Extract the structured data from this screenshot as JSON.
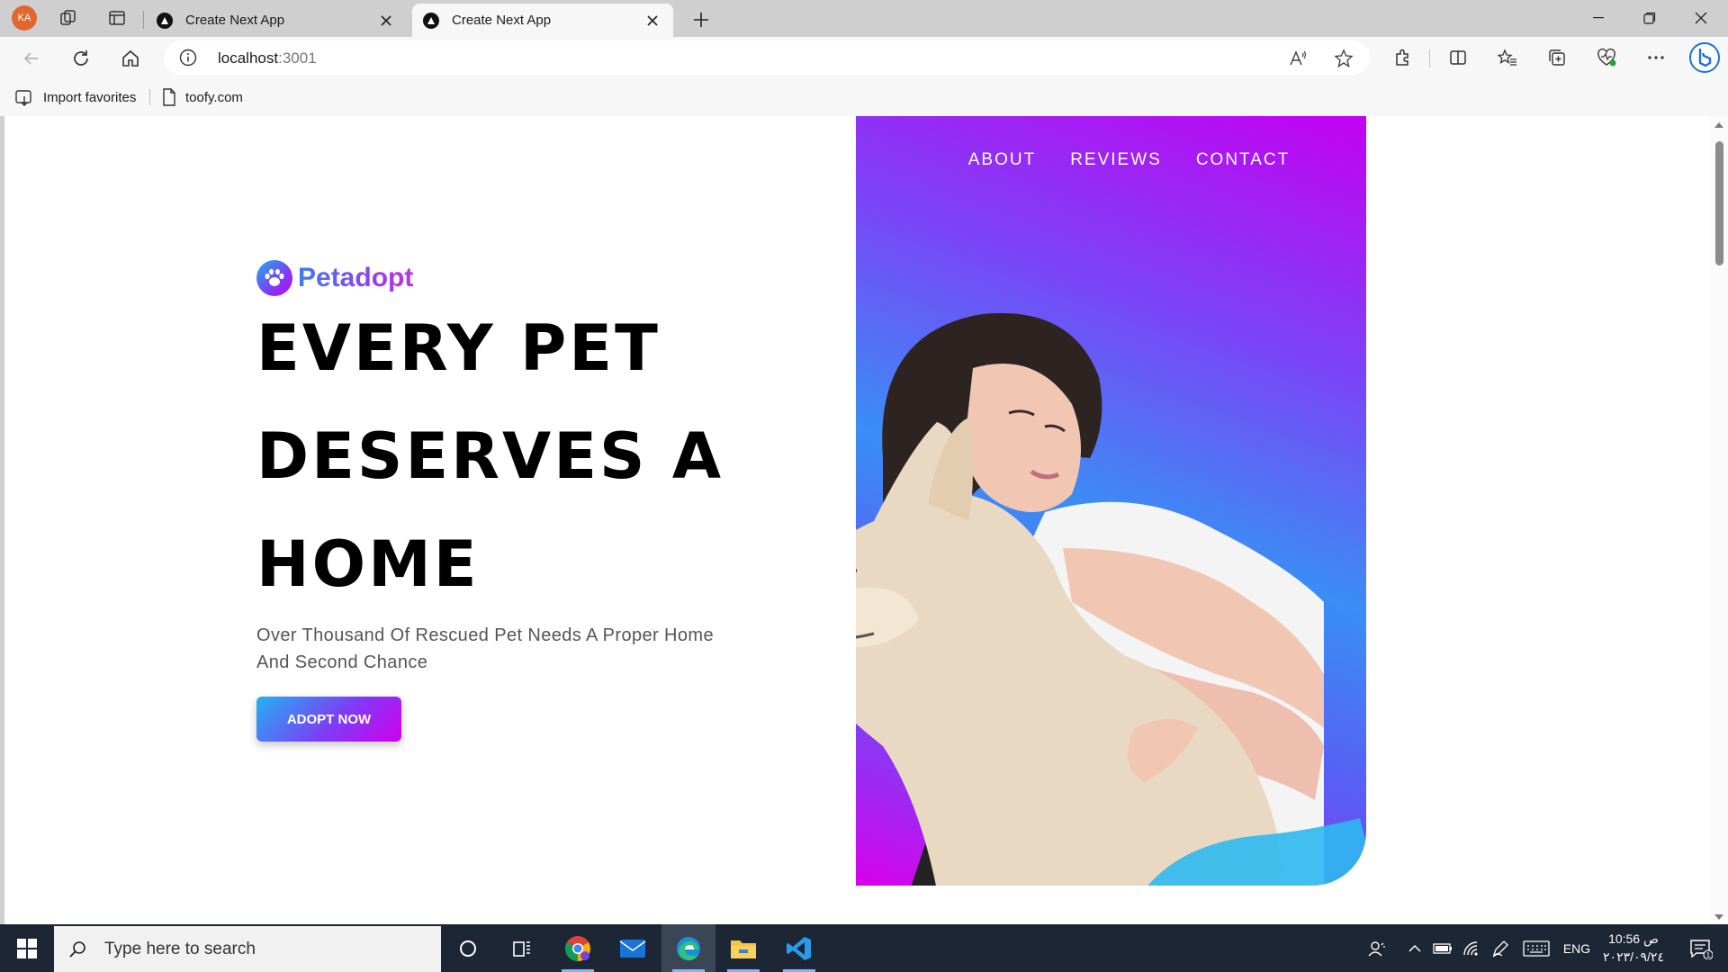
{
  "browser": {
    "profile_initials": "KA",
    "tabs": [
      {
        "title": "Create Next App",
        "active": false
      },
      {
        "title": "Create Next App",
        "active": true
      }
    ],
    "address": {
      "host": "localhost",
      "port": ":3001"
    },
    "favorites": [
      {
        "label": "Import favorites",
        "icon": "import-favorites-icon"
      },
      {
        "label": "toofy.com",
        "icon": "page-icon"
      }
    ]
  },
  "page": {
    "brand": "Petadopt",
    "headline": [
      "EVERY PET",
      "DESERVES A",
      "HOME"
    ],
    "subtitle": "Over Thousand Of Rescued Pet Needs A Proper Home And Second Chance",
    "cta": "ADOPT NOW",
    "nav": [
      "ABOUT",
      "REVIEWS",
      "CONTACT"
    ],
    "colors": {
      "gradient_start": "#1eb1f3",
      "gradient_mid": "#7d3cf5",
      "gradient_end": "#d000ee"
    }
  },
  "taskbar": {
    "search_placeholder": "Type here to search",
    "language": "ENG",
    "time": "10:56 ص",
    "date": "٢٠٢٣/٠٩/٢٤",
    "notification_count": "1"
  }
}
